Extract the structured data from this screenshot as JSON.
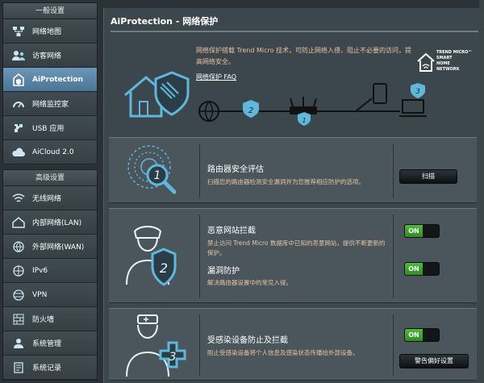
{
  "sidebar": {
    "general_header": "一般设置",
    "general_items": [
      {
        "label": "网络地图",
        "icon": "network-map-icon"
      },
      {
        "label": "访客网络",
        "icon": "guest-network-icon"
      },
      {
        "label": "AiProtection",
        "icon": "aiprotection-icon",
        "active": true
      },
      {
        "label": "网络监控家",
        "icon": "traffic-monitor-icon"
      },
      {
        "label": "USB 应用",
        "icon": "usb-app-icon"
      },
      {
        "label": "AiCloud 2.0",
        "icon": "aicloud-icon"
      }
    ],
    "advanced_header": "高级设置",
    "advanced_items": [
      {
        "label": "无线网络",
        "icon": "wireless-icon"
      },
      {
        "label": "内部网络(LAN)",
        "icon": "lan-icon"
      },
      {
        "label": "外部网络(WAN)",
        "icon": "wan-icon"
      },
      {
        "label": "IPv6",
        "icon": "ipv6-icon"
      },
      {
        "label": "VPN",
        "icon": "vpn-icon"
      },
      {
        "label": "防火墙",
        "icon": "firewall-icon"
      },
      {
        "label": "系统管理",
        "icon": "administration-icon"
      },
      {
        "label": "系统记录",
        "icon": "system-log-icon"
      }
    ]
  },
  "main": {
    "title": "AiProtection - 网络保护",
    "intro": "网络保护搭载 Trend Micro 技术，可防止网络入侵，阻止不必要的访问，提高网络安全。",
    "faq_link": "网络保护 FAQ",
    "trend_logo": {
      "line1": "TREND MICRO™",
      "line2": "SMART",
      "line3": "HOME",
      "line4": "NETWORK"
    },
    "diagram_badges": [
      "2",
      "1",
      "3"
    ]
  },
  "sections": {
    "router_assessment": {
      "number": "1",
      "title": "路由器安全评估",
      "desc": "扫描您的路由器检测安全漏洞并为您推荐相应防护的选项。",
      "button": "扫描"
    },
    "malicious_block": {
      "number": "2",
      "title": "恶意网站拦截",
      "desc": "禁止访问 Trend Micro 数据库中已知的恶意网站，提供不断更新的保护。",
      "toggle": "ON"
    },
    "vulnerability": {
      "title": "漏洞防护",
      "desc": "解决路由器设置中的常见入侵。",
      "toggle": "ON"
    },
    "infected_device": {
      "number": "3",
      "title": "受感染设备防止及拦截",
      "desc": "阻止受感染设备将个人信息及感染状态传播给外部设备。",
      "toggle": "ON",
      "button": "警告偏好设置"
    }
  },
  "colors": {
    "accent": "#5fb8dc",
    "desc_text": "#e7c3a0",
    "toggle_on": "#3ea52f"
  }
}
